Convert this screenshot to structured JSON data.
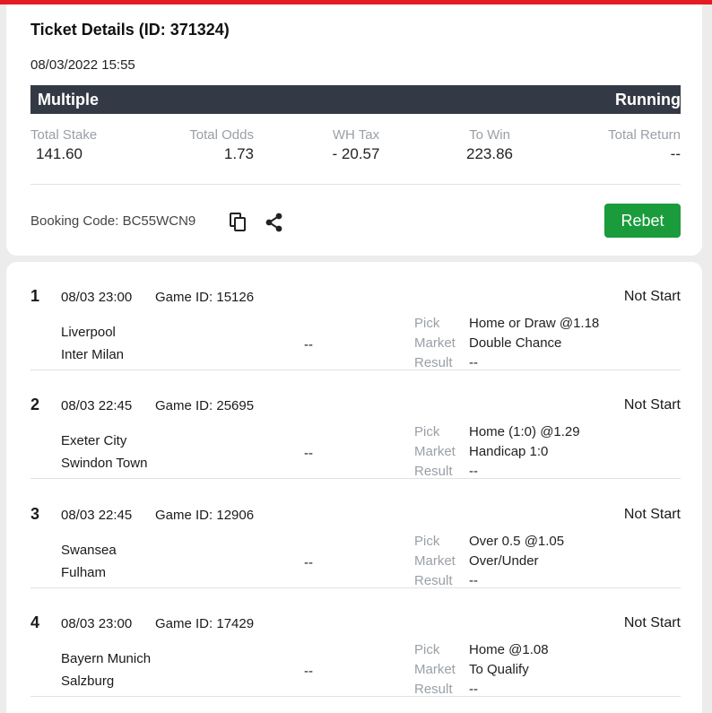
{
  "header": {
    "title": "Ticket Details (ID: 371324)",
    "datetime": "08/03/2022 15:55"
  },
  "ticket": {
    "type": "Multiple",
    "status": "Running"
  },
  "summary": [
    {
      "label": "Total Stake",
      "value": "141.60"
    },
    {
      "label": "Total Odds",
      "value": "1.73"
    },
    {
      "label": "WH Tax",
      "value": "- 20.57"
    },
    {
      "label": "To Win",
      "value": "223.86"
    },
    {
      "label": "Total Return",
      "value": "--"
    }
  ],
  "booking": {
    "label": "Booking Code: BC55WCN9",
    "rebet_label": "Rebet"
  },
  "labels": {
    "pick": "Pick",
    "market": "Market",
    "result": "Result"
  },
  "games": [
    {
      "index": "1",
      "time": "08/03 23:00",
      "game_id": "Game ID: 15126",
      "status": "Not Start",
      "home": "Liverpool",
      "away": "Inter Milan",
      "score": "--",
      "pick": "Home or Draw @1.18",
      "market": "Double Chance",
      "result": "--"
    },
    {
      "index": "2",
      "time": "08/03 22:45",
      "game_id": "Game ID: 25695",
      "status": "Not Start",
      "home": "Exeter City",
      "away": "Swindon Town",
      "score": "--",
      "pick": "Home (1:0) @1.29",
      "market": "Handicap 1:0",
      "result": "--"
    },
    {
      "index": "3",
      "time": "08/03 22:45",
      "game_id": "Game ID: 12906",
      "status": "Not Start",
      "home": "Swansea",
      "away": "Fulham",
      "score": "--",
      "pick": "Over 0.5 @1.05",
      "market": "Over/Under",
      "result": "--"
    },
    {
      "index": "4",
      "time": "08/03 23:00",
      "game_id": "Game ID: 17429",
      "status": "Not Start",
      "home": "Bayern Munich",
      "away": "Salzburg",
      "score": "--",
      "pick": "Home @1.08",
      "market": "To Qualify",
      "result": "--"
    }
  ],
  "icons": {
    "copy": "copy-icon",
    "share": "share-icon"
  },
  "colors": {
    "top_accent": "#e41b23",
    "header_bar": "#343a45",
    "rebet": "#1a9b3c",
    "muted_label": "#9aa0a6"
  }
}
